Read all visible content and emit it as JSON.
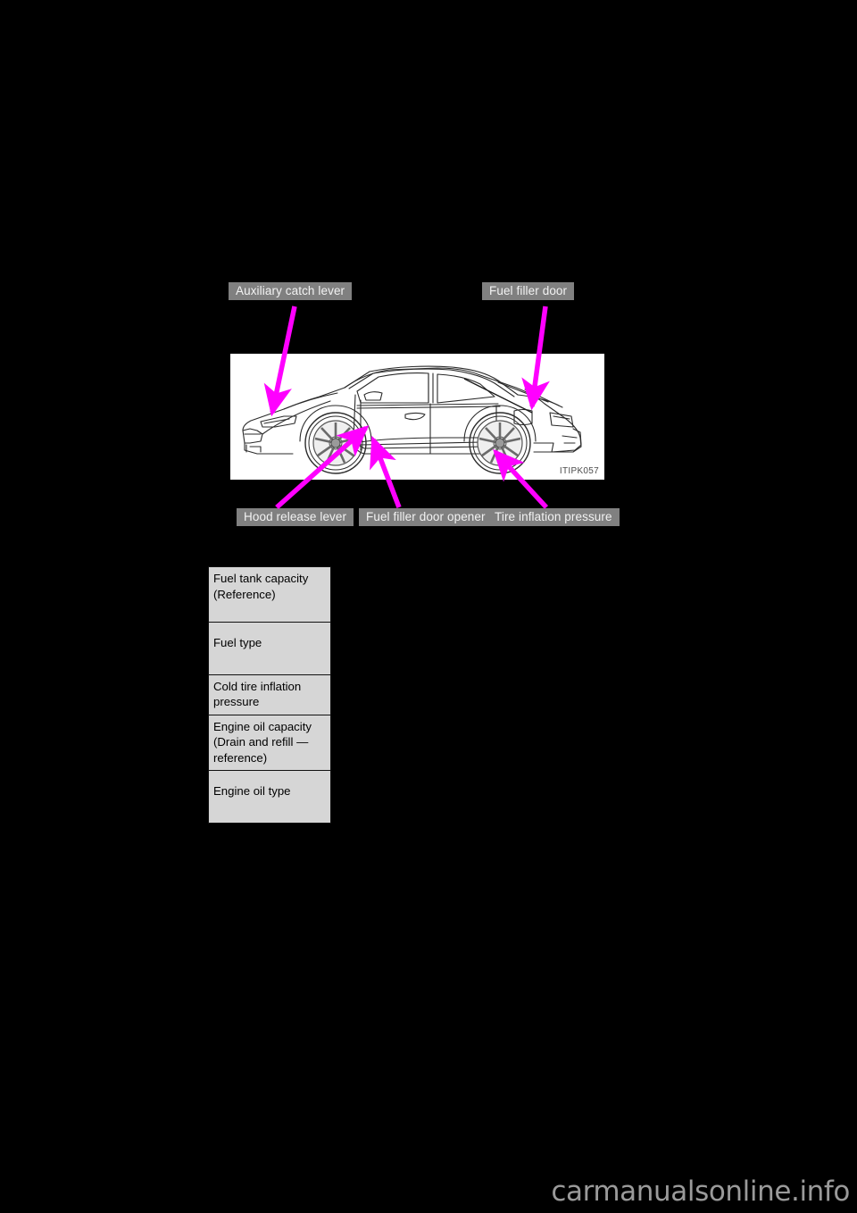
{
  "page": {
    "background_color": "#000000",
    "watermark": "carmanualsonline.info"
  },
  "illustration": {
    "figure_code": "ITIPK057",
    "subject": "vehicle-side-view-line-drawing",
    "background_color": "#ffffff",
    "arrow_color": "#ff00ff"
  },
  "callouts": [
    {
      "id": "auxiliary-catch-lever",
      "label": "Auxiliary catch lever"
    },
    {
      "id": "fuel-filler-door",
      "label": "Fuel filler door"
    },
    {
      "id": "hood-release-lever",
      "label": "Hood release lever"
    },
    {
      "id": "fuel-filler-door-opener",
      "label": "Fuel filler door opener"
    },
    {
      "id": "tire-inflation-pressure",
      "label": "Tire inflation pressure"
    }
  ],
  "spec_table": {
    "background_color": "#d6d6d6",
    "border_color": "#111111",
    "rows": [
      {
        "line1": "Fuel tank capacity",
        "line2": "(Reference)",
        "line3": ""
      },
      {
        "line1": "Fuel type",
        "line2": "",
        "line3": ""
      },
      {
        "line1": "Cold tire inflation",
        "line2": "pressure",
        "line3": ""
      },
      {
        "line1": "Engine oil capacity",
        "line2": "(Drain and refill —",
        "line3": "reference)"
      },
      {
        "line1": "Engine oil type",
        "line2": "",
        "line3": ""
      }
    ]
  }
}
